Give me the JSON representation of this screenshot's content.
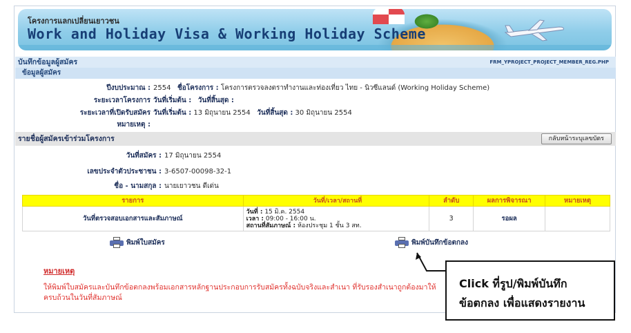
{
  "banner": {
    "title_th": "โครงการแลกเปลี่ยนเยาวชน",
    "brand": "Work and Holiday Visa & Working Holiday Scheme"
  },
  "page": {
    "title": "บันทึกข้อมูลผู้สมัคร",
    "page_code": "FRM_YPROJECT_PROJECT_MEMBER_REG.PHP",
    "section_label": "ข้อมูลผู้สมัคร"
  },
  "project_info": {
    "budget_label": "ปีงบประมาณ :",
    "budget_value": "2554",
    "project_name_label": "ชื่อโครงการ :",
    "project_name": "โครงการตรวจลงตราทำงานและท่องเที่ยว ไทย - นิวซีแลนด์ (Working Holiday Scheme)",
    "period_label": "ระยะเวลาโครงการ",
    "period_start_label": "วันที่เริ่มต้น :",
    "period_end_label": "วันที่สิ้นสุด :",
    "apply_label": "ระยะเวลาที่เปิดรับสมัคร",
    "apply_start_label": "วันที่เริ่มต้น :",
    "apply_start": "13 มิถุนายน 2554",
    "apply_end_label": "วันที่สิ้นสุด :",
    "apply_end": "30 มิถุนายน 2554",
    "note_label": "หมายเหตุ :"
  },
  "applicants": {
    "section_label": "รายชื่อผู้สมัครเข้าร่วมโครงการ",
    "back_button": "กลับหน้าระบุเลขบัตร",
    "apply_date_label": "วันที่สมัคร :",
    "apply_date": "17 มิถุนายน 2554",
    "id_label": "เลขประจำตัวประชาชน :",
    "id_value": "3-6507-00098-32-1",
    "name_label": "ชื่อ - นามสกุล :",
    "name_value": "นายเยาวชน ดีเด่น"
  },
  "schedule": {
    "headers": [
      "รายการ",
      "วันที่/เวลา/สถานที่",
      "ลำดับ",
      "ผลการพิจารณา",
      "หมายเหตุ"
    ],
    "row": {
      "item": "วันที่ตรวจสอบเอกสารและสัมภาษณ์",
      "date_label": "วันที่ :",
      "date": "15 มิ.ค. 2554",
      "time_label": "เวลา :",
      "time": "09:00 - 16:00 น.",
      "place_label": "สถานที่สัมภาษณ์ :",
      "place": "ห้องประชุม 1 ชั้น 3 สท.",
      "order": "3",
      "result": "รอผล",
      "note": ""
    }
  },
  "actions": {
    "print_application": "พิมพ์ใบสมัคร",
    "print_agreement": "พิมพ์บันทึกข้อตกลง"
  },
  "remark": {
    "title": "หมายเหตุ",
    "text": "ให้พิมพ์ใบสมัครและบันทึกข้อตกลงพร้อมเอกสารหลักฐานประกอบการรับสมัครทั้งฉบับจริงและสำเนา ที่รับรองสำเนาถูกต้องมาให้ครบถ้วนในวันที่สัมภาษณ์"
  },
  "callout": {
    "line1": "Click ที่รูป/พิมพ์บันทึก",
    "line2": "ข้อตกลง เพื่อแสดงรายงาน"
  }
}
